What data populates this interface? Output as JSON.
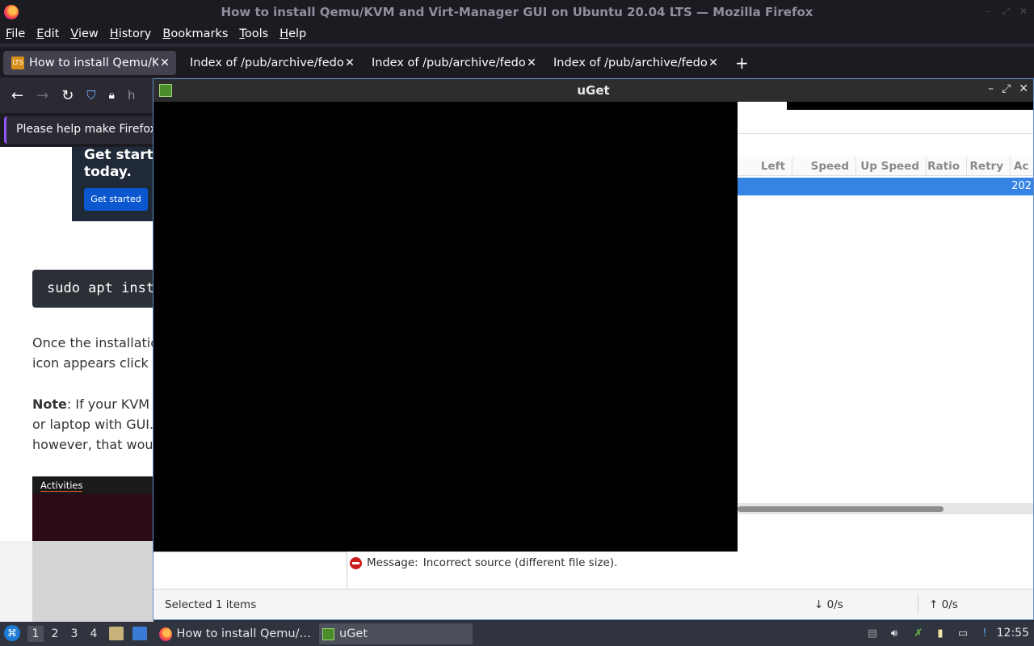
{
  "firefox": {
    "window_title": "How to install Qemu/KVM and Virt-Manager GUI on Ubuntu 20.04 LTS — Mozilla Firefox",
    "menu": [
      "File",
      "Edit",
      "View",
      "History",
      "Bookmarks",
      "Tools",
      "Help"
    ],
    "tabs": [
      {
        "label": "How to install Qemu/KVM",
        "favicon": "LTS",
        "active": true
      },
      {
        "label": "Index of /pub/archive/fedora",
        "active": false
      },
      {
        "label": "Index of /pub/archive/fedora",
        "active": false
      },
      {
        "label": "Index of /pub/archive/fedora",
        "active": false
      }
    ],
    "new_tab": "+",
    "nav": {
      "back": "←",
      "forward": "→",
      "reload": "↻",
      "url_partial": "h"
    },
    "notification": "Please help make Firefox better"
  },
  "webpage": {
    "promo_text_1": "Get started",
    "promo_text_2": "today.",
    "promo_button": "Get started",
    "code": "sudo apt install",
    "para1_line1": "Once the installation",
    "para1_line2": "icon appears click t",
    "note_label": "Note",
    "note_line1": ": If your KVM i",
    "note_line2": "or laptop with GUI.",
    "note_line3": "however, that wou",
    "screenshot_label": "Activities"
  },
  "uget": {
    "title": "uGet",
    "columns": [
      "Left",
      "Speed",
      "Up Speed",
      "Ratio",
      "Retry",
      "Ac"
    ],
    "selected_row_text": "202",
    "message_label": "Message:",
    "message_text": "Incorrect source (different file size).",
    "status_selected": "Selected 1 items",
    "download_speed": "↓  0/s",
    "upload_speed": "↑  0/s"
  },
  "taskbar": {
    "workspaces": [
      "1",
      "2",
      "3",
      "4"
    ],
    "tasks": [
      {
        "label": "How to install Qemu/…",
        "icon": "firefox-icon"
      },
      {
        "label": "uGet",
        "icon": "uget-icon",
        "active": true
      }
    ],
    "clock": "12:55"
  }
}
